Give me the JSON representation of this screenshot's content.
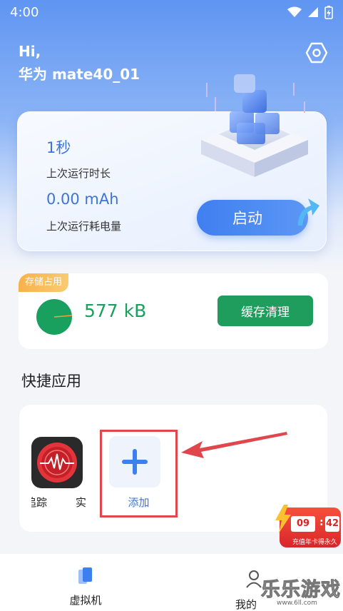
{
  "status_bar": {
    "time": "4:00",
    "icons": [
      "wifi-icon",
      "signal-icon",
      "battery-charging-icon"
    ]
  },
  "header": {
    "greeting": "Hi,",
    "device_name": "华为 mate40_01",
    "settings_icon": "hexagon-settings-icon"
  },
  "run_card": {
    "duration_value": "1秒",
    "duration_label": "上次运行时长",
    "power_value": "0.00 mAh",
    "power_label": "上次运行耗电量",
    "start_label": "启动"
  },
  "storage": {
    "tag": "存储占用",
    "size": "577 kB",
    "clean_label": "缓存清理",
    "accent": "#1f9d5c"
  },
  "quick_apps": {
    "title": "快捷应用",
    "apps": [
      {
        "label": "追踪",
        "label_tail": "实",
        "icon": "red-tracker-app-icon"
      }
    ],
    "add_label": "添加"
  },
  "promo": {
    "hours": "09",
    "minutes": "42",
    "text": "充值年卡得永久"
  },
  "bottom_nav": {
    "items": [
      {
        "label": "虚拟机",
        "icon": "phone-icon"
      },
      {
        "label": "我的",
        "icon": "person-icon"
      }
    ]
  },
  "watermark": {
    "text": "乐乐游戏",
    "url": "www.6ll.com"
  },
  "colors": {
    "primary": "#3f7ff0",
    "green": "#1f9d5c",
    "highlight": "#e0474c"
  }
}
